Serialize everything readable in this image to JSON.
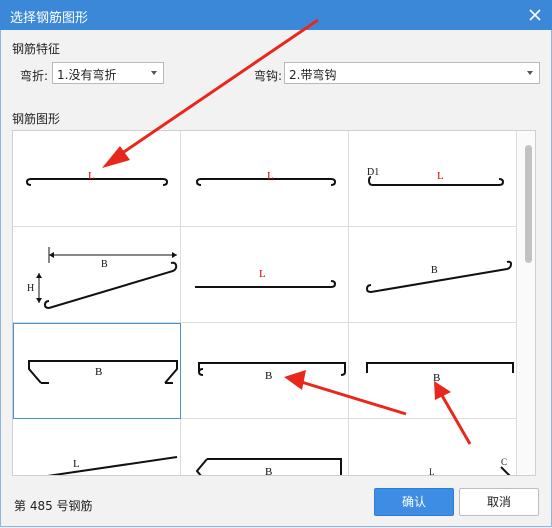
{
  "window": {
    "title": "选择钢筋图形"
  },
  "features": {
    "section_label": "钢筋特征",
    "bend_label": "弯折:",
    "bend_value": "1.没有弯折",
    "hook_label": "弯钩:",
    "hook_value": "2.带弯钩"
  },
  "shapes": {
    "section_label": "钢筋图形",
    "cells": [
      {
        "label": "L",
        "extra": ""
      },
      {
        "label": "L",
        "extra": ""
      },
      {
        "label": "L",
        "extra": "D1"
      },
      {
        "label": "B",
        "extra": "H"
      },
      {
        "label": "L",
        "extra": ""
      },
      {
        "label": "B",
        "extra": ""
      },
      {
        "label": "B",
        "extra": ""
      },
      {
        "label": "B",
        "extra": ""
      },
      {
        "label": "B",
        "extra": ""
      },
      {
        "label": "L",
        "extra": ""
      },
      {
        "label": "B",
        "extra": ""
      },
      {
        "label": "L",
        "extra": "C"
      }
    ]
  },
  "footer": {
    "status": "第 485 号钢筋",
    "ok_label": "确认",
    "cancel_label": "取消"
  },
  "colors": {
    "titlebar": "#3c88d8",
    "accent": "#3e8de4",
    "annotation_red": "#e8281c"
  }
}
